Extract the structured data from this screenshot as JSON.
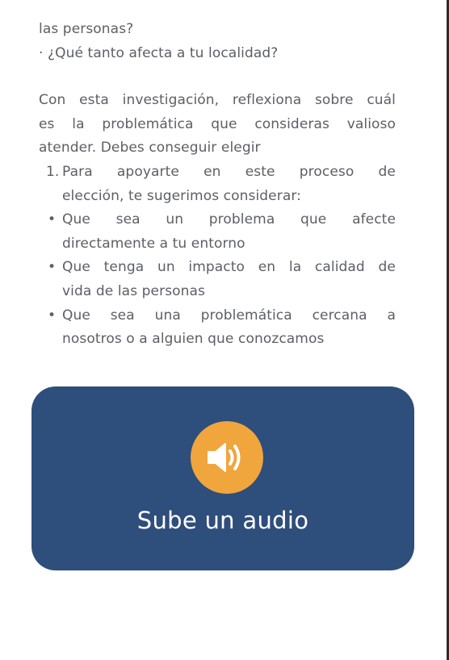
{
  "intro": {
    "line1": "las personas?",
    "line2": "· ¿Qué tanto afecta a tu localidad?"
  },
  "paragraph": {
    "line1": "Con esta investigación, reflexiona sobre cuál",
    "line2": "es la problemática que consideras valioso",
    "line3": "atender. Debes conseguir elegir"
  },
  "list": [
    {
      "marker": "1.",
      "line1": "Para apoyarte en este proceso de",
      "line2": "elección, te sugerimos considerar:"
    },
    {
      "marker": "•",
      "line1": "Que sea un problema que afecte",
      "line2": "directamente a tu entorno"
    },
    {
      "marker": "•",
      "line1": "Que tenga un impacto en la calidad de",
      "line2": "vida de las personas"
    },
    {
      "marker": "•",
      "line1": "Que sea una problemática cercana a",
      "line2": "nosotros o a alguien que conozcamos"
    }
  ],
  "audio_card": {
    "label": "Sube un audio",
    "icon": "speaker-volume-icon",
    "background_color": "#2e4e7c",
    "icon_color": "#f0a53d"
  }
}
